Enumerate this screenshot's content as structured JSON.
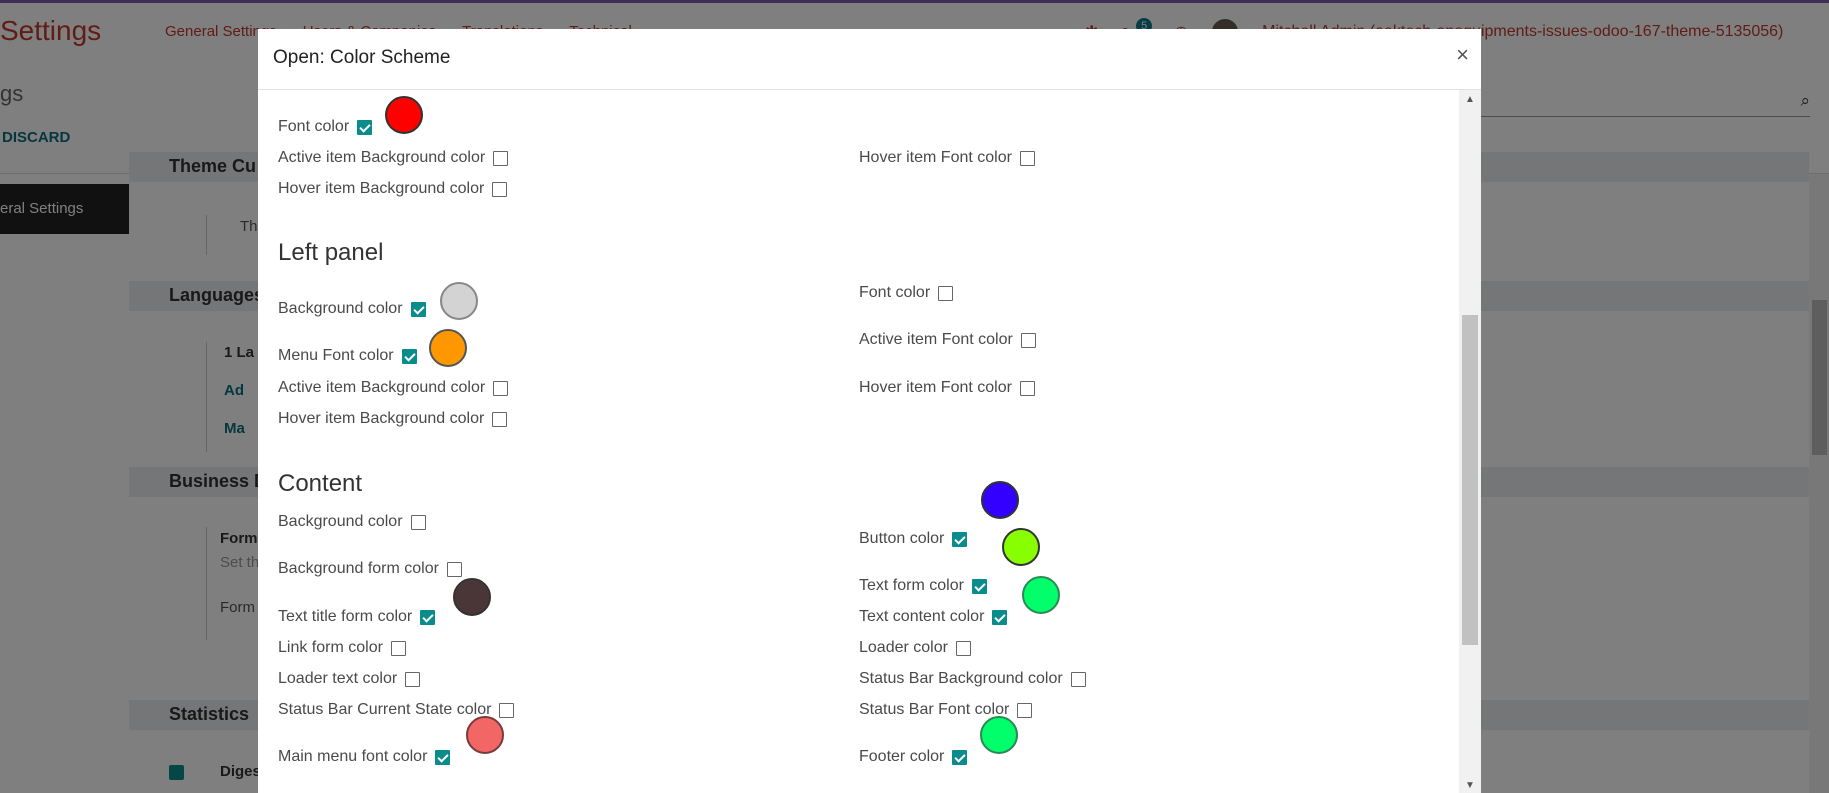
{
  "background_page": {
    "app_title": "Settings",
    "menu": [
      "General Settings",
      "Users & Companies",
      "Translations",
      "Technical"
    ],
    "chat_badge": "5",
    "user_name": "Mitchell Admin (aaktech-anequipments-issues-odoo-167-theme-5135056)",
    "breadcrumb": "gs",
    "discard_label": "DISCARD",
    "sidebar_item": "eral Settings",
    "sections": [
      "Theme Cu",
      "Languages",
      "Business D",
      "Statistics"
    ],
    "snippets": {
      "theme_text": "Th",
      "lang_count": "1 La",
      "lang_link1": "Ad",
      "lang_link2": "Ma",
      "format_title": "Form",
      "format_sub": "Set th",
      "format_line": "Form",
      "digest": "Diges"
    }
  },
  "dialog": {
    "title": "Open: Color Scheme",
    "close_symbol": "×",
    "top_group": {
      "left": [
        {
          "label": "Font color",
          "checked": true,
          "color": "#ff0000"
        },
        {
          "label": "Active item Background color",
          "checked": false
        },
        {
          "label": "Hover item Background color",
          "checked": false
        }
      ],
      "right": [
        {
          "label": "Hover item Font color",
          "checked": false
        }
      ]
    },
    "left_panel": {
      "title": "Left panel",
      "left": [
        {
          "label": "Background color",
          "checked": true,
          "color": "#d3d3d3"
        },
        {
          "label": "Menu Font color",
          "checked": true,
          "color": "#ff9800"
        },
        {
          "label": "Active item Background color",
          "checked": false
        },
        {
          "label": "Hover item Background color",
          "checked": false
        }
      ],
      "right": [
        {
          "label": "Font color",
          "checked": false
        },
        {
          "label": "Active item Font color",
          "checked": false
        },
        {
          "label": "Hover item Font color",
          "checked": false
        }
      ]
    },
    "content": {
      "title": "Content",
      "left": [
        {
          "label": "Background color",
          "checked": false
        },
        {
          "label": "Background form color",
          "checked": false
        },
        {
          "label": "Text title form color",
          "checked": true,
          "color": "#4a3636"
        },
        {
          "label": "Link form color",
          "checked": false
        },
        {
          "label": "Loader text color",
          "checked": false
        },
        {
          "label": "Status Bar Current State color",
          "checked": false
        },
        {
          "label": "Main menu font color",
          "checked": true,
          "color": "#f26666"
        }
      ],
      "right": [
        {
          "label": "Button color",
          "checked": true,
          "color": "#3300ff"
        },
        {
          "label": "Text form color",
          "checked": true,
          "color": "#88ff00"
        },
        {
          "label": "Text content color",
          "checked": true,
          "color": "#00ff6a"
        },
        {
          "label": "Loader color",
          "checked": false
        },
        {
          "label": "Status Bar Background color",
          "checked": false
        },
        {
          "label": "Status Bar Font color",
          "checked": false
        },
        {
          "label": "Footer color",
          "checked": true,
          "color": "#00ff6a"
        }
      ]
    }
  }
}
